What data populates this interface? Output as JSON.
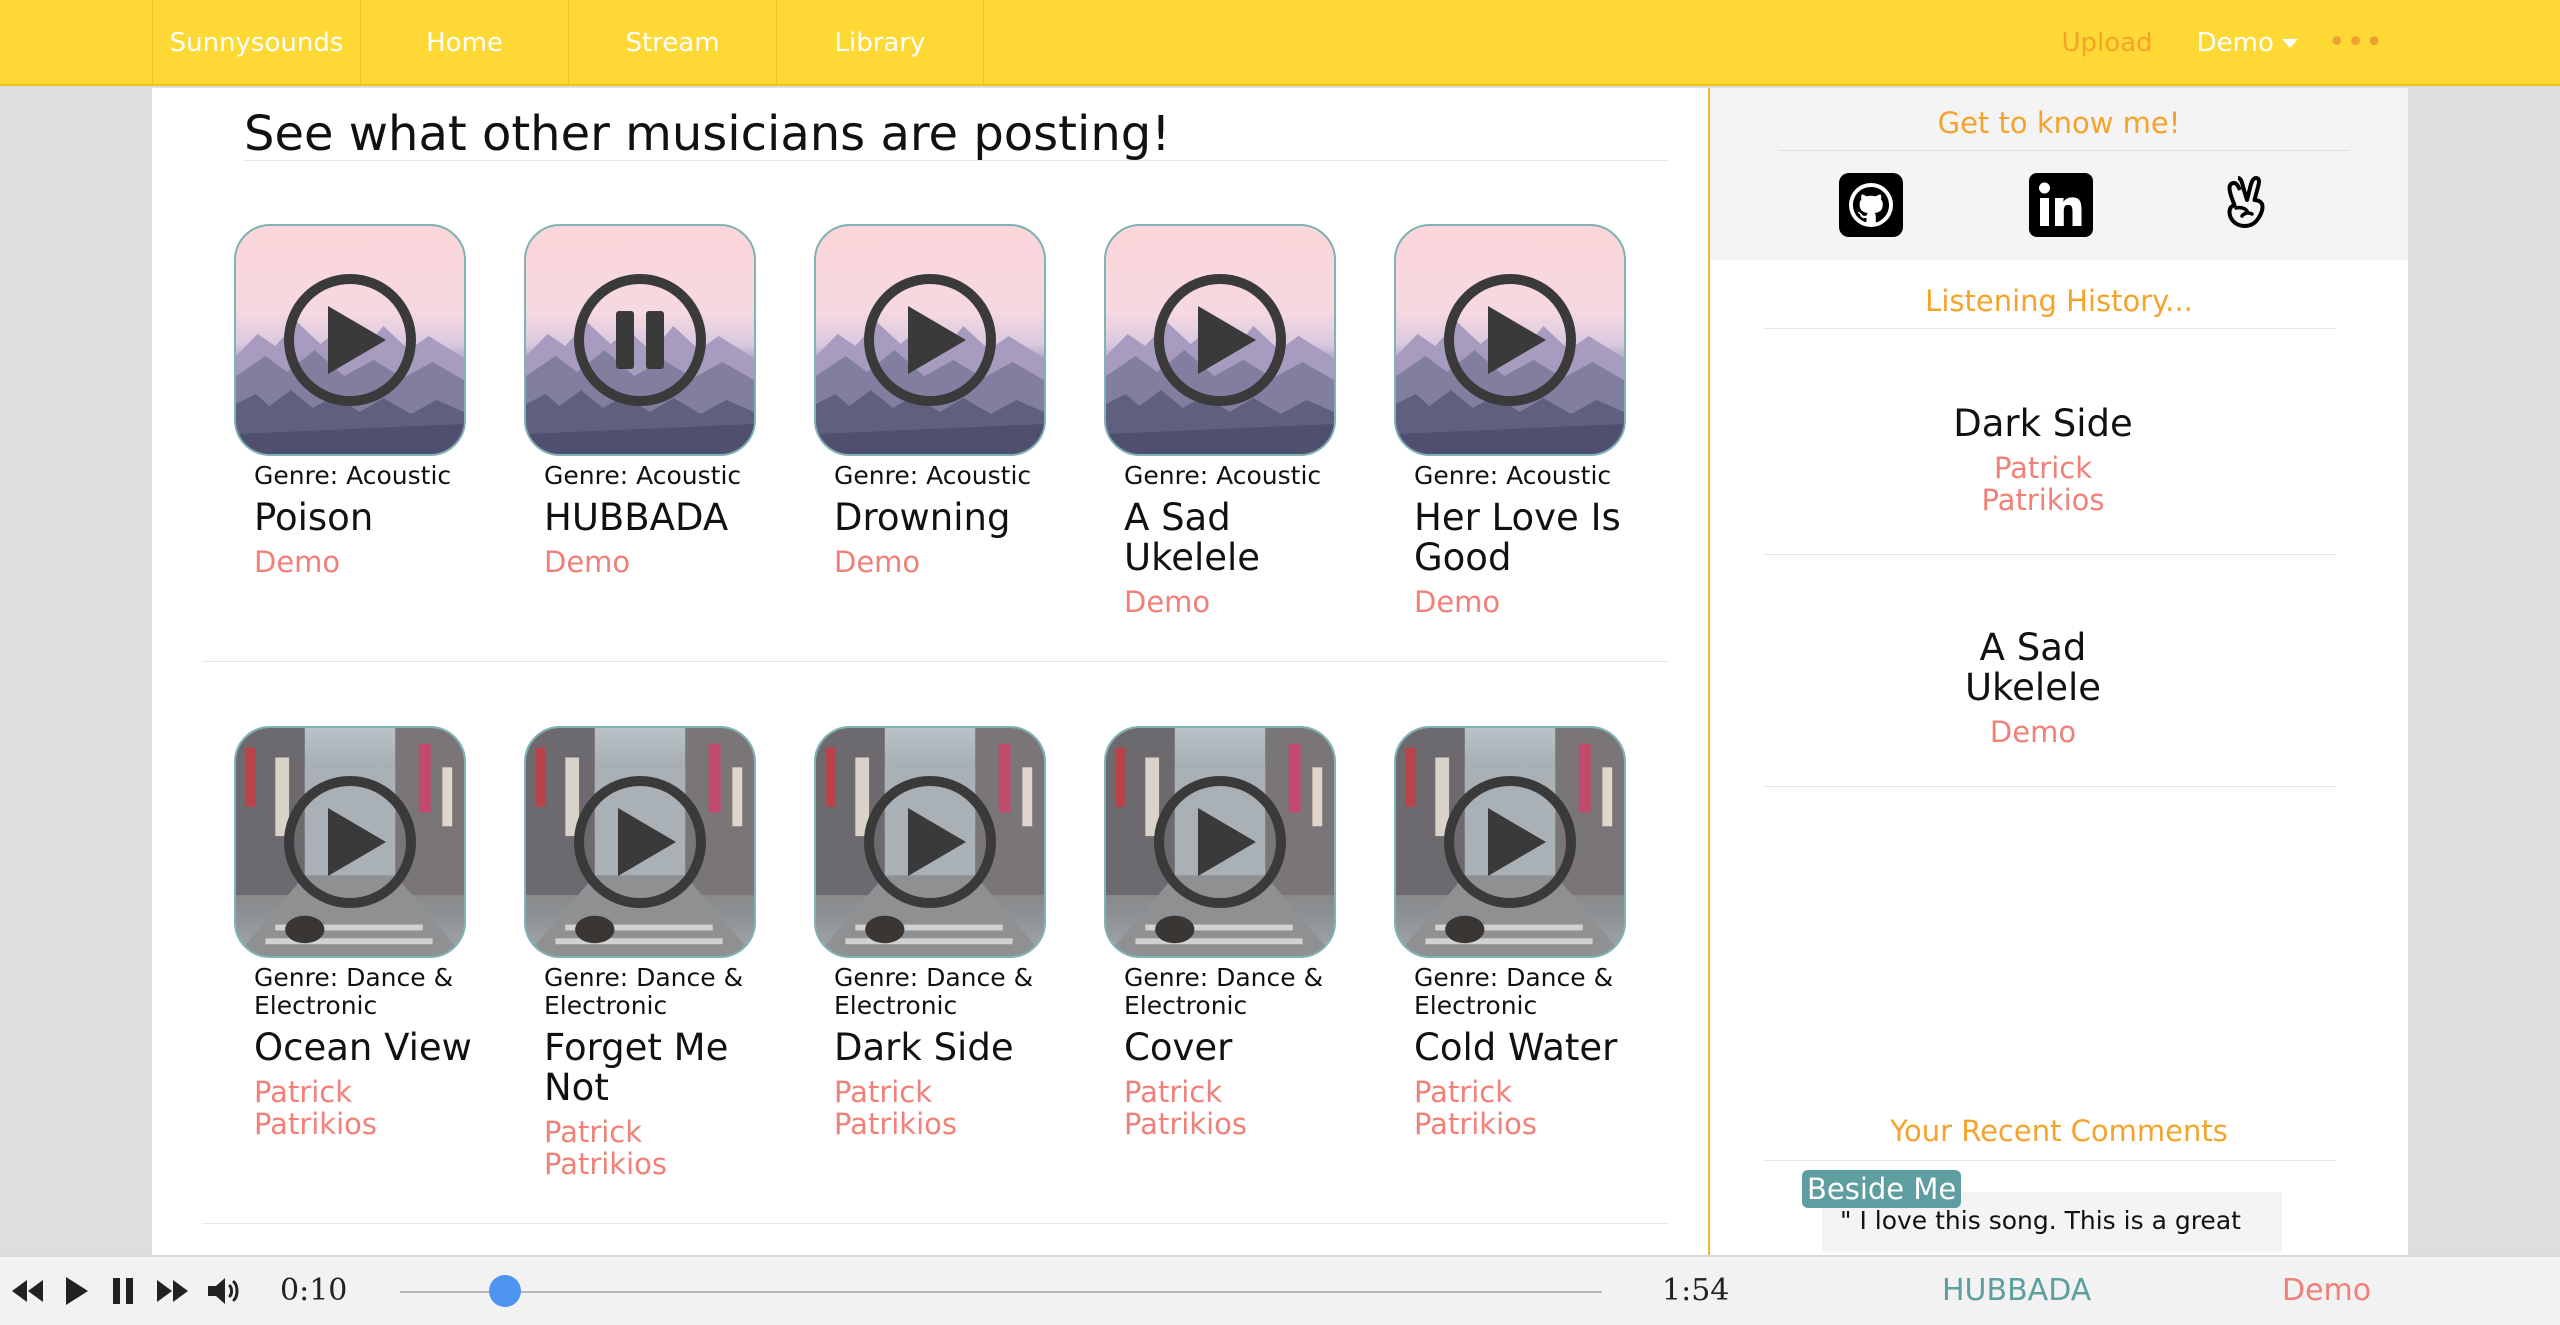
{
  "nav": {
    "brand": "Sunnysounds",
    "links": [
      "Home",
      "Stream",
      "Library"
    ],
    "upload": "Upload",
    "user": "Demo",
    "more": "•••"
  },
  "feed": {
    "title": "See what other musicians are posting!",
    "rows": [
      {
        "art": "mountain-artwork",
        "cards": [
          {
            "genre": "Genre: Acoustic",
            "title": "Poison",
            "artist": "Demo",
            "state": "play"
          },
          {
            "genre": "Genre: Acoustic",
            "title": "HUBBADA",
            "artist": "Demo",
            "state": "pause"
          },
          {
            "genre": "Genre: Acoustic",
            "title": "Drowning",
            "artist": "Demo",
            "state": "play"
          },
          {
            "genre": "Genre: Acoustic",
            "title": "A Sad Ukelele",
            "artist": "Demo",
            "state": "play"
          },
          {
            "genre": "Genre: Acoustic",
            "title": "Her Love Is Good",
            "artist": "Demo",
            "state": "play"
          }
        ]
      },
      {
        "art": "city-street-artwork",
        "cards": [
          {
            "genre": "Genre: Dance & Electronic",
            "title": "Ocean View",
            "artist": "Patrick Patrikios",
            "state": "play"
          },
          {
            "genre": "Genre: Dance & Electronic",
            "title": "Forget Me Not",
            "artist": "Patrick Patrikios",
            "state": "play"
          },
          {
            "genre": "Genre: Dance & Electronic",
            "title": "Dark Side",
            "artist": "Patrick Patrikios",
            "state": "play"
          },
          {
            "genre": "Genre: Dance & Electronic",
            "title": "Cover",
            "artist": "Patrick Patrikios",
            "state": "play"
          },
          {
            "genre": "Genre: Dance & Electronic",
            "title": "Cold Water",
            "artist": "Patrick Patrikios",
            "state": "play"
          }
        ]
      }
    ]
  },
  "sidebar": {
    "about_title": "Get to know me!",
    "socials": [
      "github-icon",
      "linkedin-icon",
      "angellist-icon"
    ],
    "history_title": "Listening History...",
    "history": [
      {
        "title": "Dark Side",
        "artist": "Patrick Patrikios"
      },
      {
        "title": "A Sad Ukelele",
        "artist": "Demo"
      }
    ],
    "comments_title": "Your Recent Comments",
    "comments": [
      {
        "song": "Beside Me",
        "text": "\" I love this song. This is a great"
      }
    ]
  },
  "player": {
    "controls": [
      "rewind-icon",
      "play-icon",
      "pause-icon",
      "fast-forward-icon",
      "volume-icon"
    ],
    "elapsed": "0:10",
    "duration": "1:54",
    "progress_fraction": 0.087,
    "now_playing_title": "HUBBADA",
    "now_playing_artist": "Demo"
  },
  "colors": {
    "nav_bg": "#fed935",
    "accent_orange": "#f5a32a",
    "artist_salmon": "#f08078",
    "teal": "#5e9ea0",
    "progress_blue": "#4f94f0"
  }
}
